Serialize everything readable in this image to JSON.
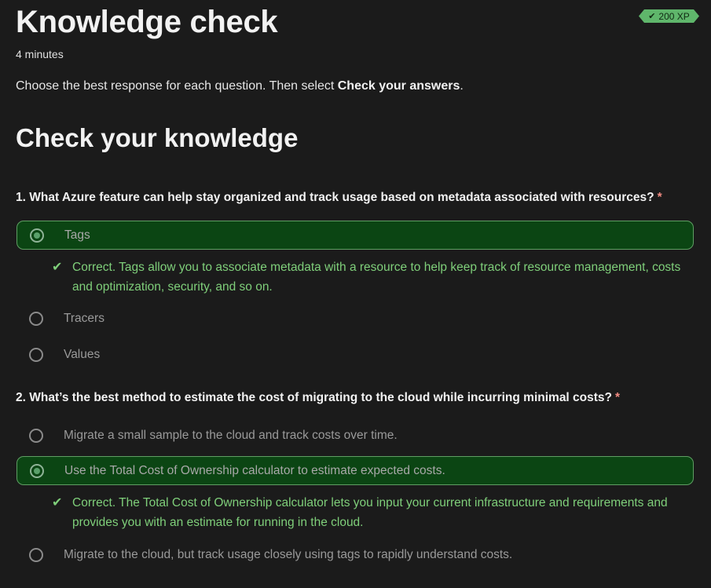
{
  "header": {
    "title": "Knowledge check",
    "duration": "4 minutes",
    "xp": "200 XP",
    "xp_icon": "check-icon"
  },
  "instructions": {
    "prefix": "Choose the best response for each question. Then select ",
    "bold": "Check your answers",
    "suffix": "."
  },
  "section": {
    "heading": "Check your knowledge"
  },
  "questions": [
    {
      "text": "1. What Azure feature can help stay organized and track usage based on metadata associated with resources?",
      "required_mark": "*",
      "options": [
        {
          "label": "Tags",
          "selected": true
        },
        {
          "label": "Tracers",
          "selected": false
        },
        {
          "label": "Values",
          "selected": false
        }
      ],
      "feedback": "Correct. Tags allow you to associate metadata with a resource to help keep track of resource management, costs and optimization, security, and so on."
    },
    {
      "text": "2. What’s the best method to estimate the cost of migrating to the cloud while incurring minimal costs?",
      "required_mark": "*",
      "options": [
        {
          "label": "Migrate a small sample to the cloud and track costs over time.",
          "selected": false
        },
        {
          "label": "Use the Total Cost of Ownership calculator to estimate expected costs.",
          "selected": true
        },
        {
          "label": "Migrate to the cloud, but track usage closely using tags to rapidly understand costs.",
          "selected": false
        }
      ],
      "feedback": "Correct. The Total Cost of Ownership calculator lets you input your current infrastructure and requirements and provides you with an estimate for running in the cloud."
    }
  ],
  "colors": {
    "background": "#1b1b1b",
    "selected_bg": "#0b4513",
    "selected_border": "#5f9e63",
    "correct_text": "#7fcf7a",
    "xp_badge": "#5fb66b",
    "required": "#f28b82"
  }
}
